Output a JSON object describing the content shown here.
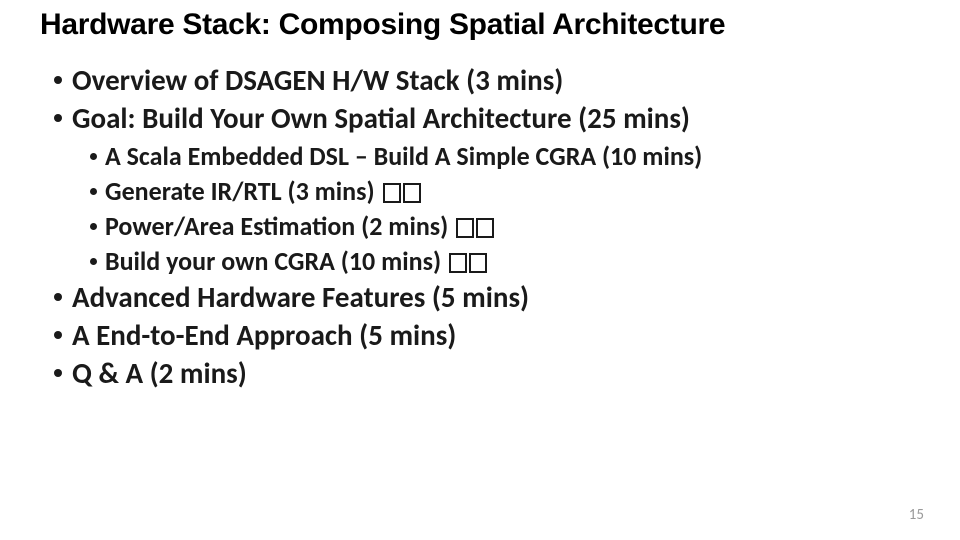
{
  "title": "Hardware Stack: Composing Spatial Architecture",
  "bullets": {
    "b1": "Overview of DSAGEN H/W Stack (3 mins)",
    "b2": "Goal: Build Your Own Spatial Architecture (25 mins)",
    "b2_1": "A Scala Embedded DSL – Build A Simple CGRA (10 mins)",
    "b2_2": "Generate IR/RTL (3 mins)",
    "b2_3": "Power/Area Estimation (2 mins)",
    "b2_4": "Build your own CGRA (10 mins)",
    "b3": "Advanced Hardware Features (5 mins)",
    "b4": "A End-to-End Approach (5 mins)",
    "b5": "Q & A (2 mins)"
  },
  "page_number": "15"
}
